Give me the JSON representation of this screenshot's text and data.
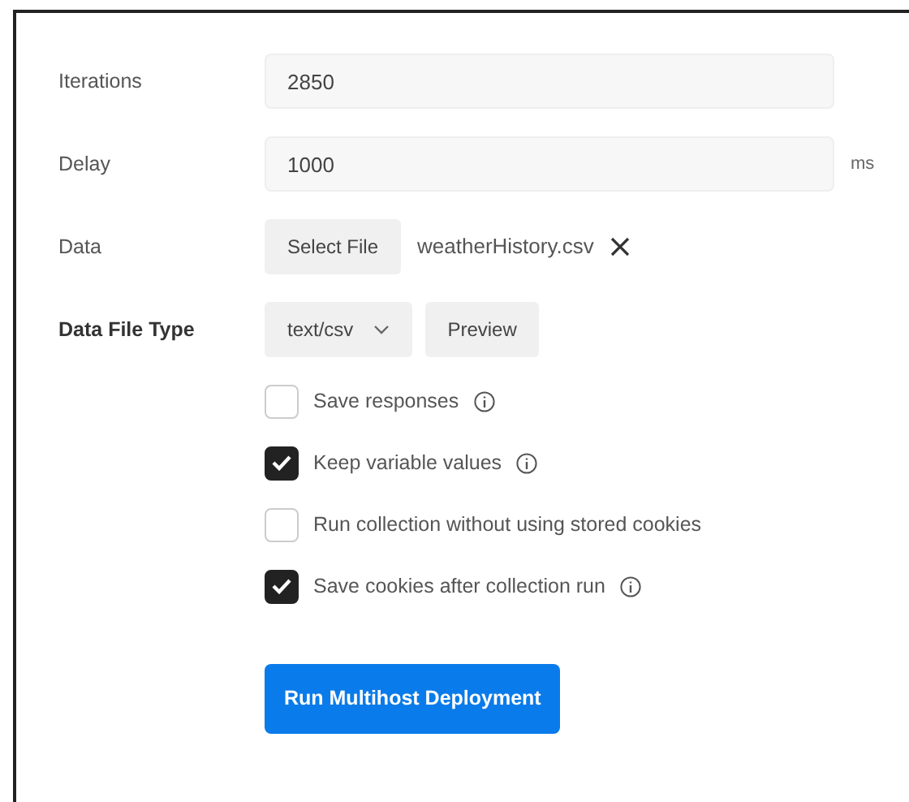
{
  "fields": [
    {
      "kind": "input",
      "label": "Iterations",
      "value": "2850"
    },
    {
      "kind": "input",
      "label": "Delay",
      "value": "1000",
      "unit": "ms"
    },
    {
      "kind": "file",
      "label": "Data",
      "button": "Select File",
      "filename": "weatherHistory.csv"
    },
    {
      "kind": "select",
      "label": "Data File Type",
      "value": "text/csv",
      "button": "Preview"
    }
  ],
  "options": [
    {
      "label": "Save responses",
      "checked": false,
      "info": true
    },
    {
      "label": "Keep variable values",
      "checked": true,
      "info": true
    },
    {
      "label": "Run collection without using stored cookies",
      "checked": false,
      "info": false
    },
    {
      "label": "Save cookies after collection run",
      "checked": true,
      "info": true
    }
  ],
  "run_button": "Run Multihost Deployment"
}
